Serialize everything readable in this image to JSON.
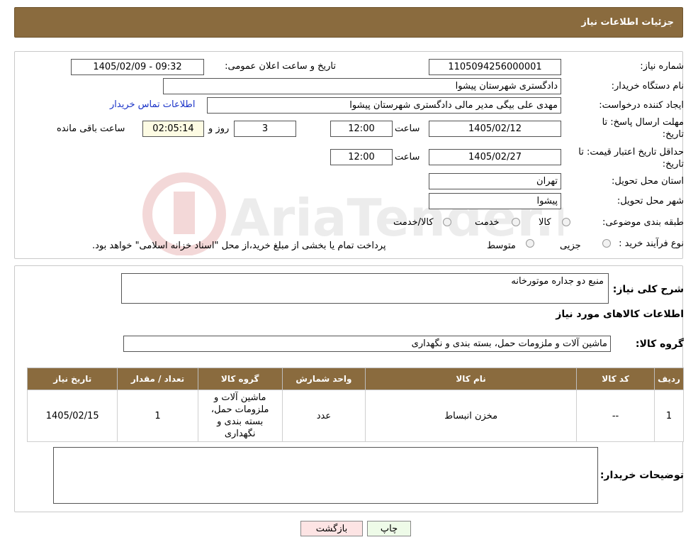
{
  "header": {
    "title": "جزئیات اطلاعات نیاز"
  },
  "form": {
    "need_number_label": "شماره نیاز:",
    "need_number": "1105094256000001",
    "announce_label": "تاریخ و ساعت اعلان عمومی:",
    "announce_value": "1405/02/09 - 09:32",
    "buyer_org_label": "نام دستگاه خریدار:",
    "buyer_org": "دادگستری شهرستان پیشوا",
    "requester_label": "ایجاد کننده درخواست:",
    "requester": "مهدی علی بیگی مدیر مالی دادگستری شهرستان پیشوا",
    "contact_link": "اطلاعات تماس خریدار",
    "deadline_label_1": "مهلت ارسال پاسخ: تا",
    "deadline_label_2": "تاریخ:",
    "deadline_date": "1405/02/12",
    "time_label": "ساعت",
    "deadline_time": "12:00",
    "days_value": "3",
    "days_label": "روز و",
    "remaining_time": "02:05:14",
    "remaining_label": "ساعت باقی مانده",
    "validity_label_1": "حداقل تاریخ اعتبار قیمت: تا",
    "validity_label_2": "تاریخ:",
    "validity_date": "1405/02/27",
    "validity_time": "12:00",
    "province_label": "استان محل تحویل:",
    "province": "تهران",
    "city_label": "شهر محل تحویل:",
    "city": "پیشوا",
    "category_label": "طبقه بندی موضوعی:",
    "category_options": [
      "کالا",
      "خدمت",
      "کالا/خدمت"
    ],
    "process_label": "نوع فرآیند خرید :",
    "process_options": [
      "جزیی",
      "متوسط"
    ],
    "process_note": "پرداخت تمام یا بخشی از مبلغ خرید،از محل \"اسناد خزانه اسلامی\" خواهد بود."
  },
  "description": {
    "label": "شرح کلی نیاز:",
    "value": "منبع دو جداره موتورخانه"
  },
  "goods": {
    "section_title": "اطلاعات کالاهای مورد نیاز",
    "group_label": "گروه کالا:",
    "group_value": "ماشین آلات و ملزومات حمل، بسته بندی و نگهداری",
    "columns": [
      "ردیف",
      "کد کالا",
      "نام کالا",
      "واحد شمارش",
      "گروه کالا",
      "تعداد / مقدار",
      "تاریخ نیاز"
    ],
    "rows": [
      {
        "row": "1",
        "code": "--",
        "name": "مخزن انبساط",
        "unit": "عدد",
        "group": "ماشین آلات و ملزومات حمل، بسته بندی و نگهداری",
        "qty": "1",
        "date": "1405/02/15"
      }
    ]
  },
  "buyer_notes": {
    "label": "توضیحات خریدار:",
    "value": ""
  },
  "buttons": {
    "print": "چاپ",
    "back": "بازگشت"
  },
  "watermark": {
    "text": "AriaTender.neT"
  },
  "colors": {
    "header_bg": "#8a6b3e",
    "link": "#1a33c8",
    "back_button_bg": "#fde4e4",
    "print_button_bg": "#eefbe8"
  }
}
